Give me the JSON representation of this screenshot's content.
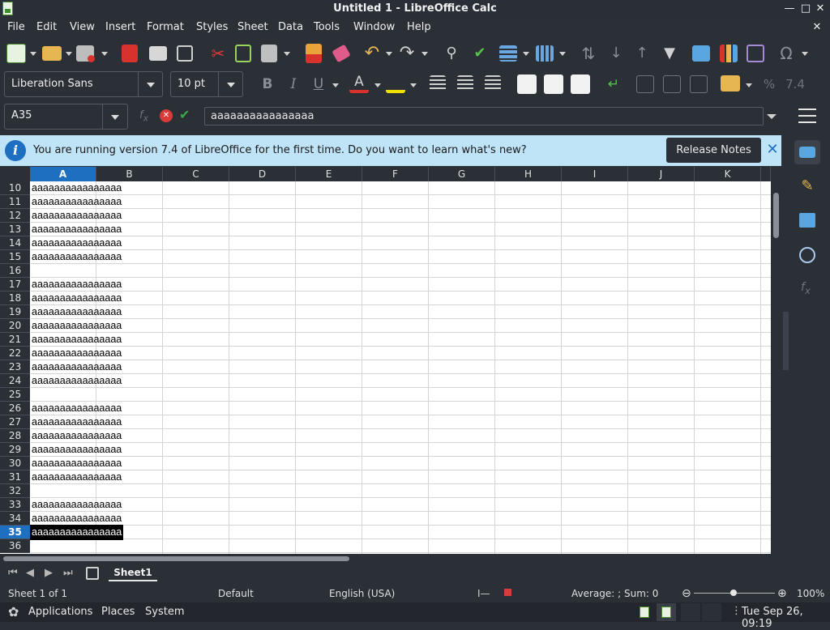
{
  "window": {
    "title": "Untitled 1 - LibreOffice Calc"
  },
  "menu": [
    "File",
    "Edit",
    "View",
    "Insert",
    "Format",
    "Styles",
    "Sheet",
    "Data",
    "Tools",
    "Window",
    "Help"
  ],
  "format": {
    "font_name": "Liberation Sans",
    "font_size": "10 pt",
    "indent_value": "7.4"
  },
  "formula": {
    "cell_ref": "A35",
    "content": "aaaaaaaaaaaaaaaa"
  },
  "infobar": {
    "message": "You are running version 7.4 of LibreOffice for the first time. Do you want to learn what's new?",
    "button": "Release Notes"
  },
  "grid": {
    "columns": [
      "A",
      "B",
      "C",
      "D",
      "E",
      "F",
      "G",
      "H",
      "I",
      "J",
      "K"
    ],
    "rows": [
      {
        "n": "10",
        "a": "aaaaaaaaaaaaaaaa"
      },
      {
        "n": "11",
        "a": "aaaaaaaaaaaaaaaa"
      },
      {
        "n": "12",
        "a": "aaaaaaaaaaaaaaaa"
      },
      {
        "n": "13",
        "a": "aaaaaaaaaaaaaaaa"
      },
      {
        "n": "14",
        "a": "aaaaaaaaaaaaaaaa"
      },
      {
        "n": "15",
        "a": "aaaaaaaaaaaaaaaa"
      },
      {
        "n": "16",
        "a": ""
      },
      {
        "n": "17",
        "a": "aaaaaaaaaaaaaaaa"
      },
      {
        "n": "18",
        "a": "aaaaaaaaaaaaaaaa"
      },
      {
        "n": "19",
        "a": "aaaaaaaaaaaaaaaa"
      },
      {
        "n": "20",
        "a": "aaaaaaaaaaaaaaaa"
      },
      {
        "n": "21",
        "a": "aaaaaaaaaaaaaaaa"
      },
      {
        "n": "22",
        "a": "aaaaaaaaaaaaaaaa"
      },
      {
        "n": "23",
        "a": "aaaaaaaaaaaaaaaa"
      },
      {
        "n": "24",
        "a": "aaaaaaaaaaaaaaaa"
      },
      {
        "n": "25",
        "a": ""
      },
      {
        "n": "26",
        "a": "aaaaaaaaaaaaaaaa"
      },
      {
        "n": "27",
        "a": "aaaaaaaaaaaaaaaa"
      },
      {
        "n": "28",
        "a": "aaaaaaaaaaaaaaaa"
      },
      {
        "n": "29",
        "a": "aaaaaaaaaaaaaaaa"
      },
      {
        "n": "30",
        "a": "aaaaaaaaaaaaaaaa"
      },
      {
        "n": "31",
        "a": "aaaaaaaaaaaaaaaa"
      },
      {
        "n": "32",
        "a": ""
      },
      {
        "n": "33",
        "a": "aaaaaaaaaaaaaaaa"
      },
      {
        "n": "34",
        "a": "aaaaaaaaaaaaaaaa"
      },
      {
        "n": "35",
        "a": "aaaaaaaaaaaaaaaa"
      },
      {
        "n": "36",
        "a": ""
      }
    ],
    "active_row": "35"
  },
  "sheets": {
    "tab": "Sheet1"
  },
  "status": {
    "sheet": "Sheet 1 of 1",
    "style": "Default",
    "language": "English (USA)",
    "summary": "Average: ; Sum: 0",
    "zoom": "100%"
  },
  "taskbar": {
    "applications": "Applications",
    "places": "Places",
    "system": "System",
    "clock": "Tue Sep 26, 09:19"
  },
  "colors": {
    "accent": "#1e6fbf",
    "info_bg": "#bfe3f7",
    "chrome": "#2b2f36",
    "cancel": "#d93b3b",
    "ok": "#3aa84b"
  }
}
